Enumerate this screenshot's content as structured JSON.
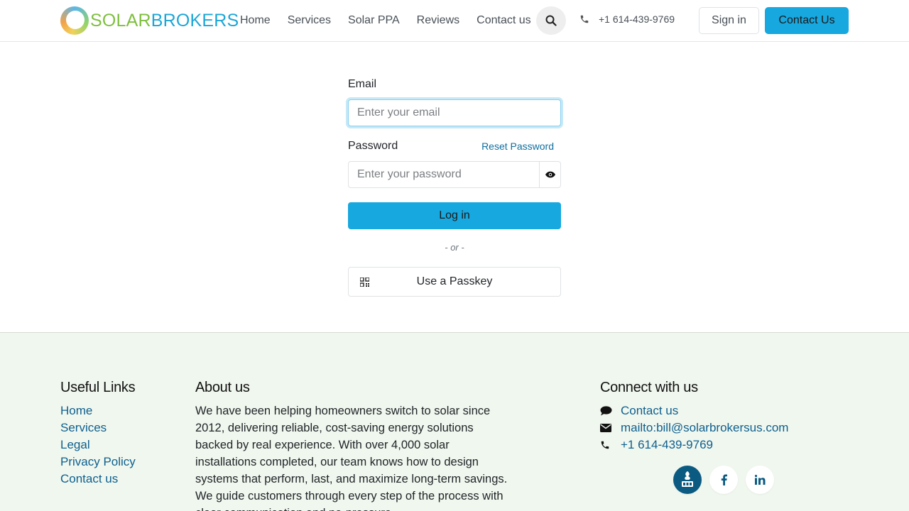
{
  "header": {
    "logo": {
      "part1": "SOLAR",
      "part2": "BROKERS"
    },
    "nav": [
      "Home",
      "Services",
      "Solar PPA",
      "Reviews",
      "Contact us"
    ],
    "phone": "+1 614-439-9769",
    "sign_in": "Sign in",
    "contact_us": "Contact Us"
  },
  "login": {
    "email_label": "Email",
    "email_placeholder": "Enter your email",
    "password_label": "Password",
    "reset_password": "Reset Password",
    "password_placeholder": "Enter your password",
    "login_button": "Log in",
    "or_text": "- or -",
    "passkey_button": "Use a Passkey"
  },
  "footer": {
    "useful_links_title": "Useful Links",
    "useful_links": [
      "Home",
      "Services",
      "Legal",
      "Privacy Policy",
      "Contact us"
    ],
    "about_title": "About us",
    "about_text": "We have been helping homeowners switch to solar since 2012, delivering reliable, cost-saving energy solutions backed by real experience. With over 4,000 solar installations completed, our team knows how to design systems that perform, last, and maximize long-term savings. We guide customers through every step of the process with clear communication and no-pressure",
    "connect_title": "Connect with us",
    "connect": {
      "contact": "Contact us",
      "email": "mailto:bill@solarbrokersus.com",
      "phone": "+1 614-439-9769"
    },
    "social_icons": [
      "bbb-icon",
      "facebook-icon",
      "linkedin-icon"
    ]
  },
  "colors": {
    "primary": "#18a8e0",
    "link": "#0e5f8f",
    "footer_bg": "#f0f7ee"
  }
}
